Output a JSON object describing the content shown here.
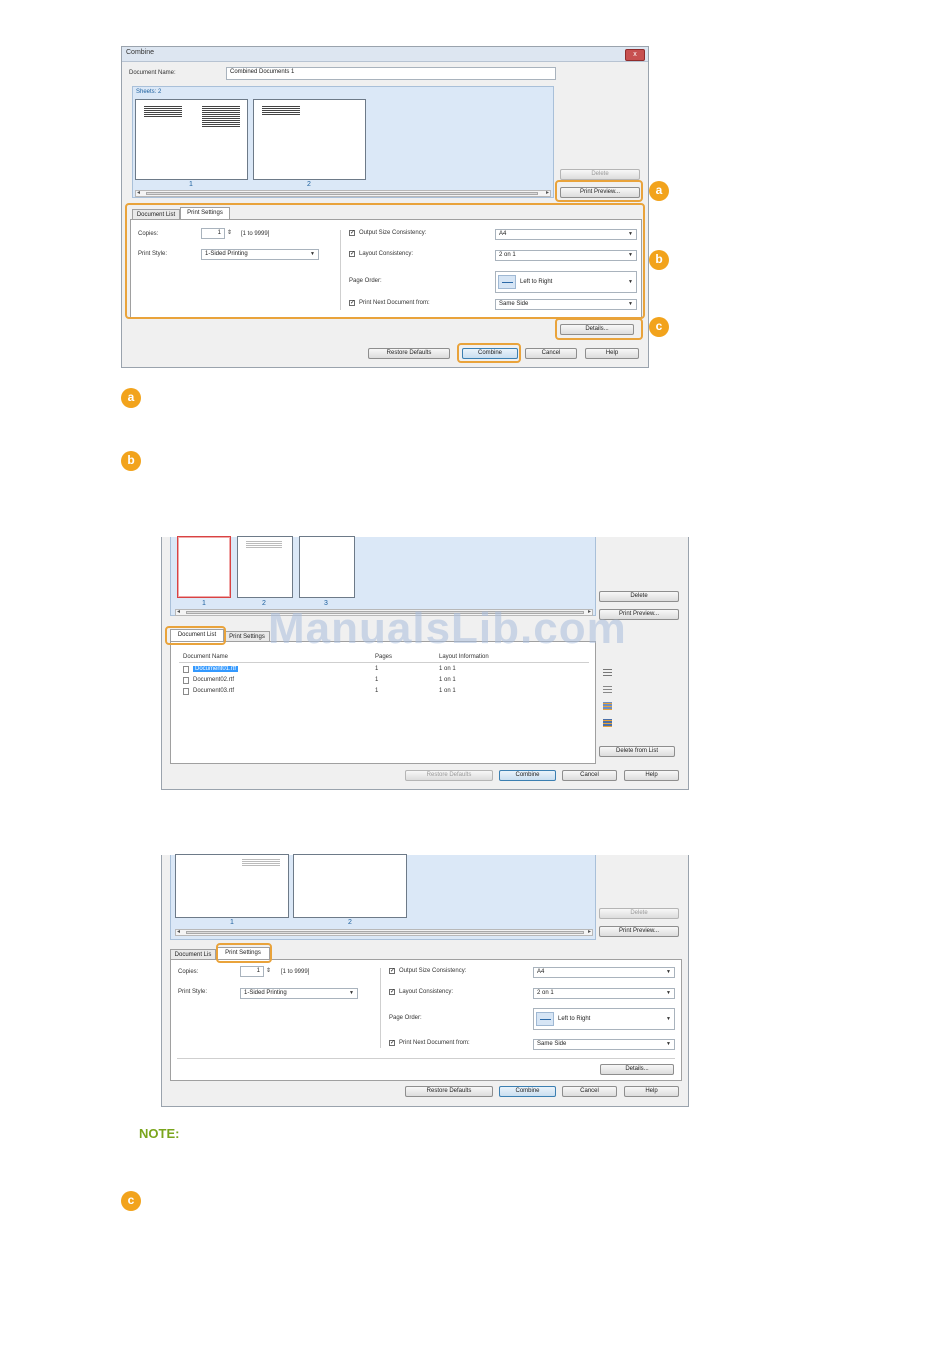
{
  "dialog1": {
    "title": "Combine",
    "close": "x",
    "doc_name_label": "Document Name:",
    "doc_name_value": "Combined Documents 1",
    "sheets_label": "Sheets: 2",
    "sheet_numbers": [
      "1",
      "2"
    ],
    "delete": "Delete",
    "print_preview": "Print Preview...",
    "tabs": [
      "Document List",
      "Print Settings"
    ],
    "copies_label": "Copies:",
    "copies_value": "1",
    "copies_range": "[1 to 9999]",
    "print_style_label": "Print Style:",
    "print_style_value": "1-Sided Printing",
    "output_size_label": "Output Size Consistency:",
    "output_size_value": "A4",
    "layout_label": "Layout Consistency:",
    "layout_value": "2 on 1",
    "page_order_label": "Page Order:",
    "page_order_value": "Left to Right",
    "print_next_label": "Print Next Document from:",
    "print_next_value": "Same Side",
    "details": "Details...",
    "restore": "Restore Defaults",
    "combine": "Combine",
    "cancel": "Cancel",
    "help": "Help"
  },
  "badges": {
    "a": "a",
    "b": "b",
    "c": "c"
  },
  "dialog2": {
    "sheet_numbers": [
      "1",
      "2",
      "3"
    ],
    "delete": "Delete",
    "print_preview": "Print Preview...",
    "tabs": [
      "Document List",
      "Print Settings"
    ],
    "columns": [
      "Document Name",
      "Pages",
      "Layout Information"
    ],
    "rows": [
      {
        "name": "Document01.rtf",
        "pages": "1",
        "layout": "1 on 1"
      },
      {
        "name": "Document02.rtf",
        "pages": "1",
        "layout": "1 on 1"
      },
      {
        "name": "Document03.rtf",
        "pages": "1",
        "layout": "1 on 1"
      }
    ],
    "delete_from_list": "Delete from List",
    "restore": "Restore Defaults",
    "combine": "Combine",
    "cancel": "Cancel",
    "help": "Help"
  },
  "watermark": "ManualsLib.com",
  "dialog3": {
    "sheet_numbers": [
      "1",
      "2"
    ],
    "delete": "Delete",
    "print_preview": "Print Preview...",
    "tabs": [
      "Document Lis",
      "Print Settings"
    ],
    "copies_label": "Copies:",
    "copies_value": "1",
    "copies_range": "[1 to 9999]",
    "print_style_label": "Print Style:",
    "print_style_value": "1-Sided Printing",
    "output_size_label": "Output Size Consistency:",
    "output_size_value": "A4",
    "layout_label": "Layout Consistency:",
    "layout_value": "2 on 1",
    "page_order_label": "Page Order:",
    "page_order_value": "Left to Right",
    "print_next_label": "Print Next Document from:",
    "print_next_value": "Same Side",
    "details": "Details...",
    "restore": "Restore Defaults",
    "combine": "Combine",
    "cancel": "Cancel",
    "help": "Help"
  },
  "note_label": "NOTE:"
}
